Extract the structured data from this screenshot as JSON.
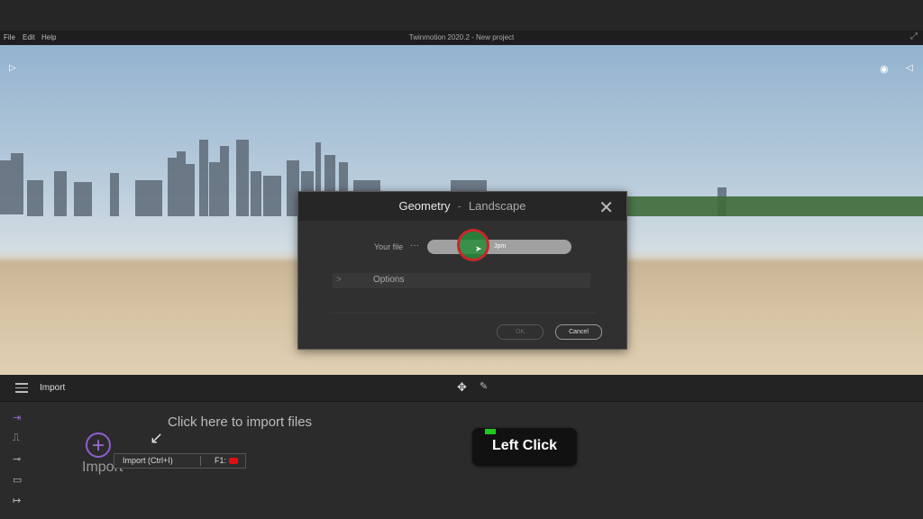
{
  "app": {
    "title": "Twinmotion 2020.2 - New project",
    "menu": [
      "File",
      "Edit",
      "Help"
    ]
  },
  "dialog": {
    "tab_active": "Geometry",
    "separator": "-",
    "tab_inactive": "Landscape",
    "file_label": "Your file",
    "file_dots": "···",
    "file_value": "Jpm",
    "options_label": "Options",
    "ok_label": "OK",
    "cancel_label": "Cancel"
  },
  "toolbar": {
    "title": "Import"
  },
  "panel": {
    "import_label": "Import",
    "hint": "Click here to import files",
    "tooltip_shortcut": "Import (Ctrl+I)",
    "tooltip_help": "F1:"
  },
  "overlay": {
    "badge": "Left Click"
  },
  "icons": [
    "play-icon",
    "eye-icon",
    "collapse-icon",
    "maximize-icon",
    "close-icon",
    "cursor-icon",
    "hamburger-icon",
    "move-icon",
    "pipette-icon",
    "import-icon",
    "plus-icon"
  ],
  "colors": {
    "accent": "#9b6bd6",
    "click_ring": "#c8282a",
    "click_fill": "#2e8c3c",
    "indicator": "#1ec81e",
    "help_key": "#e01010"
  }
}
